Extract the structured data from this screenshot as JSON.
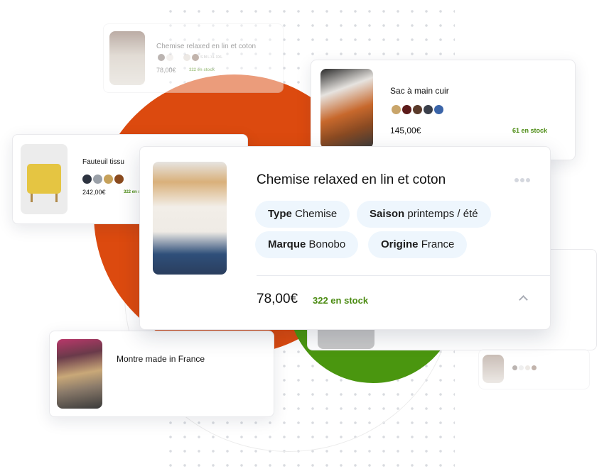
{
  "main_card": {
    "title": "Chemise relaxed en lin et coton",
    "attributes": [
      {
        "key": "Type",
        "value": "Chemise"
      },
      {
        "key": "Saison",
        "value": "printemps / été"
      },
      {
        "key": "Marque",
        "value": "Bonobo"
      },
      {
        "key": "Origine",
        "value": "France"
      }
    ],
    "price": "78,00€",
    "stock": "322 en stock",
    "menu_icon": "more-dots-icon",
    "toggle_icon": "chevron-up-icon"
  },
  "faded_card": {
    "title": "Chemise relaxed en lin et coton",
    "sizes": "S M L XL XXL",
    "price": "78,00€",
    "stock": "322 en stock"
  },
  "bag_card": {
    "title": "Sac à main cuir",
    "price": "145,00€",
    "stock": "61 en stock",
    "swatches": [
      "#c9a56a",
      "#5c1a1a",
      "#5a3a2a",
      "#3a3f4a",
      "#3a64a8"
    ]
  },
  "armchair_card": {
    "title": "Fauteuil tissu",
    "price": "242,00€",
    "stock": "322 en s",
    "swatches": [
      "#2d3340",
      "#9aa0a8",
      "#c6a15a",
      "#8a4a1e"
    ]
  },
  "watch_card": {
    "title": "Montre made in France"
  },
  "colors": {
    "orange": "#dc4a0f",
    "green": "#4a960f",
    "stock_green": "#4b8b12"
  }
}
